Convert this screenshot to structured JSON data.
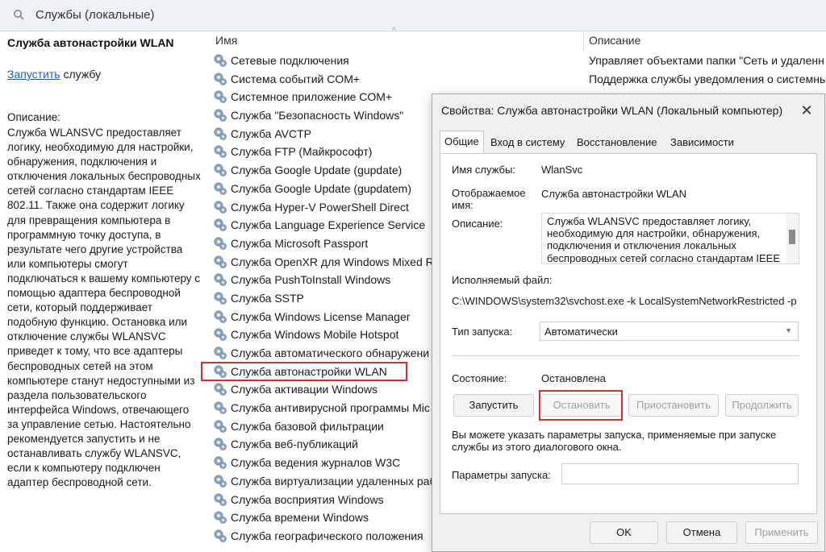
{
  "window": {
    "title": "Службы (локальные)"
  },
  "left_pane": {
    "service_title": "Служба автонастройки WLAN",
    "start_link": "Запустить",
    "start_suffix": " службу",
    "description_heading": "Описание:",
    "description": "Служба WLANSVC предоставляет логику, необходимую для настройки, обнаружения, подключения и отключения локальных беспроводных сетей согласно стандартам IEEE 802.11. Также она содержит логику для превращения компьютера в программную точку доступа, в результате чего другие устройства или компьютеры смогут подключаться к вашему компьютеру с помощью адаптера беспроводной сети, который поддерживает подобную функцию. Остановка или отключение службы WLANSVC приведет к тому, что все адаптеры беспроводных сетей на этом компьютере станут недоступными из раздела пользовательского интерфейса Windows, отвечающего за управление сетью. Настоятельно рекомендуется запустить и не останавливать службу WLANSVC, если к компьютеру подключен адаптер беспроводной сети."
  },
  "list": {
    "columns": {
      "name": "Имя",
      "description": "Описание"
    },
    "rows": [
      {
        "name": "Сетевые подключения",
        "desc": "Управляет объектами папки \"Сеть и удаленн"
      },
      {
        "name": "Система событий COM+",
        "desc": "Поддержка службы уведомления о системны"
      },
      {
        "name": "Системное приложение COM+",
        "desc": ""
      },
      {
        "name": "Служба \"Безопасность Windows\"",
        "desc": ""
      },
      {
        "name": "Служба AVCTP",
        "desc": ""
      },
      {
        "name": "Служба FTP (Майкрософт)",
        "desc": ""
      },
      {
        "name": "Служба Google Update (gupdate)",
        "desc": ""
      },
      {
        "name": "Служба Google Update (gupdatem)",
        "desc": ""
      },
      {
        "name": "Служба Hyper-V PowerShell Direct",
        "desc": ""
      },
      {
        "name": "Служба Language Experience Service",
        "desc": ""
      },
      {
        "name": "Служба Microsoft Passport",
        "desc": ""
      },
      {
        "name": "Служба OpenXR для Windows Mixed Re",
        "desc": ""
      },
      {
        "name": "Служба PushToInstall Windows",
        "desc": ""
      },
      {
        "name": "Служба SSTP",
        "desc": ""
      },
      {
        "name": "Служба Windows License Manager",
        "desc": ""
      },
      {
        "name": "Служба Windows Mobile Hotspot",
        "desc": ""
      },
      {
        "name": "Служба автоматического обнаружени",
        "desc": ""
      },
      {
        "name": "Служба автонастройки WLAN",
        "desc": ""
      },
      {
        "name": "Служба активации Windows",
        "desc": ""
      },
      {
        "name": "Служба антивирусной программы Mic",
        "desc": ""
      },
      {
        "name": "Служба базовой фильтрации",
        "desc": ""
      },
      {
        "name": "Служба веб-публикаций",
        "desc": ""
      },
      {
        "name": "Служба ведения журналов W3C",
        "desc": ""
      },
      {
        "name": "Служба виртуализации удаленных раб",
        "desc": ""
      },
      {
        "name": "Служба восприятия Windows",
        "desc": ""
      },
      {
        "name": "Служба времени Windows",
        "desc": ""
      },
      {
        "name": "Служба географического положения",
        "desc": ""
      }
    ]
  },
  "dialog": {
    "title": "Свойства: Служба автонастройки WLAN (Локальный компьютер)",
    "close_glyph": "✕",
    "tabs": [
      "Общие",
      "Вход в систему",
      "Восстановление",
      "Зависимости"
    ],
    "service_name_label": "Имя службы:",
    "service_name_value": "WlanSvc",
    "display_name_label": "Отображаемое имя:",
    "display_name_value": "Служба автонастройки WLAN",
    "description_label": "Описание:",
    "description_value": "Служба WLANSVC предоставляет логику, необходимую для настройки, обнаружения, подключения и отключения локальных беспроводных сетей согласно стандартам IEEE",
    "exe_label": "Исполняемый файл:",
    "exe_path": "C:\\WINDOWS\\system32\\svchost.exe -k LocalSystemNetworkRestricted -p",
    "startup_type_label": "Тип запуска:",
    "startup_type_value": "Автоматически",
    "status_label": "Состояние:",
    "status_value": "Остановлена",
    "btn_start": "Запустить",
    "btn_stop": "Остановить",
    "btn_pause": "Приостановить",
    "btn_resume": "Продолжить",
    "hint": "Вы можете указать параметры запуска, применяемые при запуске службы из этого диалогового окна.",
    "params_label": "Параметры запуска:",
    "params_value": "",
    "btn_ok": "OK",
    "btn_cancel": "Отмена",
    "btn_apply": "Применить"
  },
  "colors": {
    "highlight": "#d32f2f",
    "link": "#1a5fb4"
  }
}
